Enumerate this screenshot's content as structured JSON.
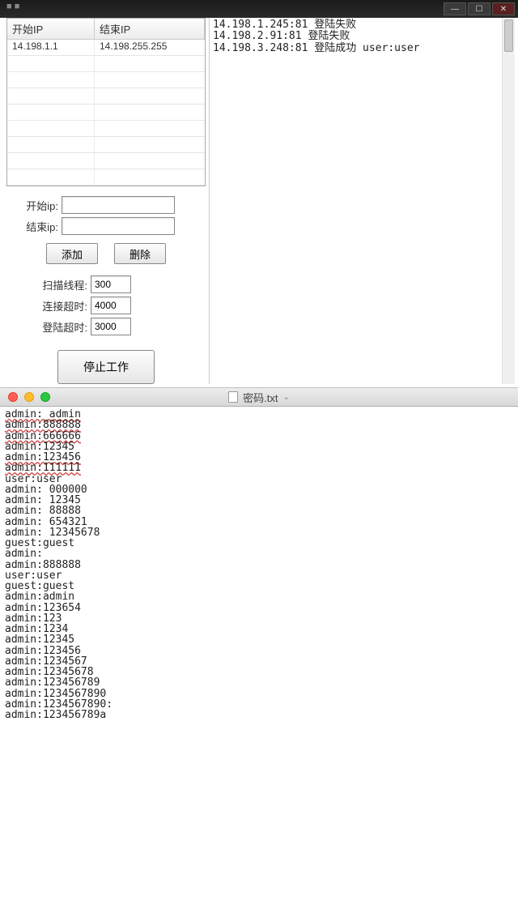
{
  "win": {
    "table": {
      "head_start": "开始IP",
      "head_end": "结束IP",
      "rows": [
        {
          "start": "14.198.1.1",
          "end": "14.198.255.255"
        }
      ]
    },
    "form": {
      "start_ip_label": "开始ip:",
      "end_ip_label": "结束ip:",
      "start_ip_value": "",
      "end_ip_value": "",
      "add_btn": "添加",
      "del_btn": "删除",
      "threads_label": "扫描线程:",
      "threads_value": "300",
      "conn_timeout_label": "连接超时:",
      "conn_timeout_value": "4000",
      "login_timeout_label": "登陆超时:",
      "login_timeout_value": "3000",
      "stop_btn": "停止工作"
    },
    "log": [
      "14.198.1.245:81 登陆失败",
      "14.198.2.91:81 登陆失败",
      "14.198.3.248:81 登陆成功 user:user"
    ]
  },
  "mac": {
    "title": "密码.txt",
    "lines": [
      "admin: admin",
      "admin:888888",
      "admin:666666",
      "admin:12345",
      "admin:123456",
      "admin:111111",
      "user:user",
      "admin: 000000",
      "admin: 12345",
      "admin: 88888",
      "admin: 654321",
      "admin: 12345678",
      "guest:guest",
      "admin:",
      "admin:888888",
      "user:user",
      "guest:guest",
      "admin:admin",
      "admin:123654",
      "admin:123",
      "admin:1234",
      "admin:12345",
      "admin:123456",
      "admin:1234567",
      "admin:12345678",
      "admin:123456789",
      "admin:1234567890",
      "admin:1234567890:",
      "admin:123456789a"
    ],
    "underlined_indices": [
      0,
      1,
      2,
      4,
      5
    ]
  }
}
